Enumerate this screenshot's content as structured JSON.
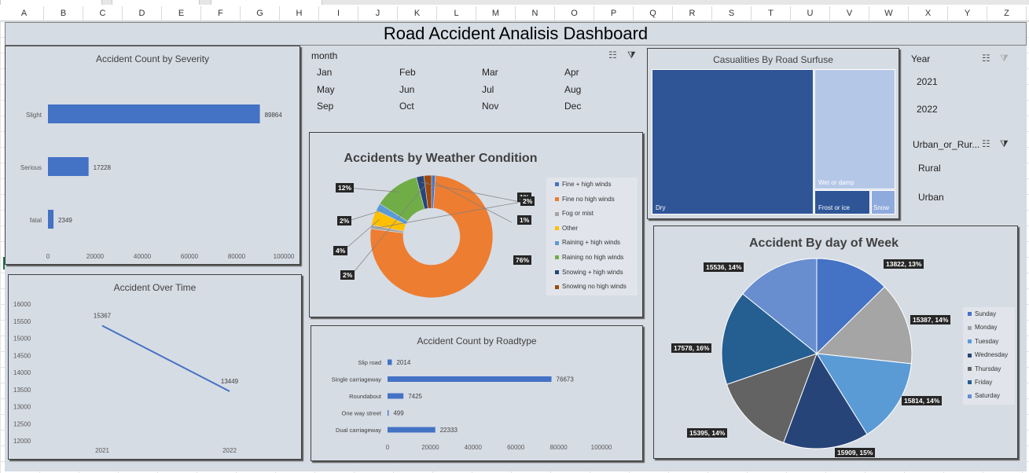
{
  "dashboard": {
    "title": "Road  Accident Analisis Dashboard"
  },
  "columns": [
    "A",
    "B",
    "C",
    "D",
    "E",
    "F",
    "G",
    "H",
    "I",
    "J",
    "K",
    "L",
    "M",
    "N",
    "O",
    "P",
    "Q",
    "R",
    "S",
    "T",
    "U",
    "V",
    "W",
    "X",
    "Y",
    "Z"
  ],
  "severity_chart": {
    "title": "Accident Count by Severity",
    "chart_data": {
      "type": "bar",
      "orientation": "horizontal",
      "title": "Accident Count by Severity",
      "categories": [
        "Slight",
        "Serious",
        "fatal"
      ],
      "values": [
        89864,
        17228,
        2349
      ],
      "xlim": [
        0,
        100000
      ],
      "ticks": [
        "0",
        "20000",
        "40000",
        "60000",
        "80000",
        "100000"
      ]
    }
  },
  "time_chart": {
    "title": "Accident Over Time",
    "chart_data": {
      "type": "line",
      "title": "Accident Over Time",
      "x": [
        "2021",
        "2022"
      ],
      "values": [
        15367,
        13449
      ],
      "ylim": [
        12000,
        16000
      ],
      "yticks": [
        "16000",
        "15500",
        "15000",
        "14500",
        "14000",
        "13500",
        "13000",
        "12500",
        "12000"
      ]
    }
  },
  "month_slicer": {
    "header": "month",
    "items": [
      "Jan",
      "Feb",
      "Mar",
      "Apr",
      "May",
      "Jun",
      "Jul",
      "Aug",
      "Sep",
      "Oct",
      "Nov",
      "Dec"
    ]
  },
  "weather_chart": {
    "title": "Accidents by Weather Condition",
    "chart_data": {
      "type": "pie",
      "variant": "donut",
      "title": "Accidents by Weather Condition",
      "categories": [
        "Fine + high winds",
        "Fine no high winds",
        "Fog or mist",
        "Other",
        "Raining + high winds",
        "Raining no high winds",
        "Snowing + high winds",
        "Snowing no high winds"
      ],
      "values": [
        1,
        76,
        1,
        4,
        2,
        12,
        2,
        2
      ],
      "labels": [
        "1%",
        "76%",
        "1%",
        "4%",
        "2%",
        "12%",
        "2%",
        "2%"
      ],
      "colors": [
        "#4472c4",
        "#ed7d31",
        "#a5a5a5",
        "#ffc000",
        "#5b9bd5",
        "#70ad47",
        "#264478",
        "#9e480e"
      ]
    }
  },
  "roadtype_chart": {
    "title": "Accident Count by Roadtype",
    "chart_data": {
      "type": "bar",
      "orientation": "horizontal",
      "title": "Accident Count by Roadtype",
      "categories": [
        "Slip road",
        "Single carriageway",
        "Roundabout",
        "One way street",
        "Dual carriageway"
      ],
      "values": [
        2014,
        76673,
        7425,
        499,
        22333
      ],
      "xlim": [
        0,
        100000
      ],
      "ticks": [
        "0",
        "20000",
        "40000",
        "60000",
        "80000",
        "100000"
      ]
    }
  },
  "surface_chart": {
    "title": "Casualities By  Road Surfuse",
    "chart_data": {
      "type": "treemap",
      "title": "Casualities By  Road Surfuse",
      "categories": [
        "Dry",
        "Wet or damp",
        "Frost or ice",
        "Snow"
      ],
      "colors": [
        "#2f5597",
        "#b4c7e7",
        "#2f5597",
        "#8faadc"
      ]
    }
  },
  "year_slicer": {
    "header": "Year",
    "items": [
      "2021",
      "2022"
    ]
  },
  "area_slicer": {
    "header": "Urban_or_Rur...",
    "items": [
      "Rural",
      "Urban"
    ]
  },
  "dow_chart": {
    "title": "Accident By day of Week",
    "chart_data": {
      "type": "pie",
      "title": "Accident By day of Week",
      "categories": [
        "Sunday",
        "Monday",
        "Tuesday",
        "Wednesday",
        "Thursday",
        "Friday",
        "Saturday"
      ],
      "values": [
        13822,
        15387,
        15814,
        15909,
        15395,
        17578,
        15536
      ],
      "labels": [
        "13822, 13%",
        "15387, 14%",
        "15814, 14%",
        "15909, 15%",
        "15395, 14%",
        "17578, 16%",
        "15536, 14%"
      ],
      "colors": [
        "#4472c4",
        "#a5a5a5",
        "#5b9bd5",
        "#264478",
        "#636363",
        "#255e91",
        "#698ed0"
      ]
    }
  }
}
